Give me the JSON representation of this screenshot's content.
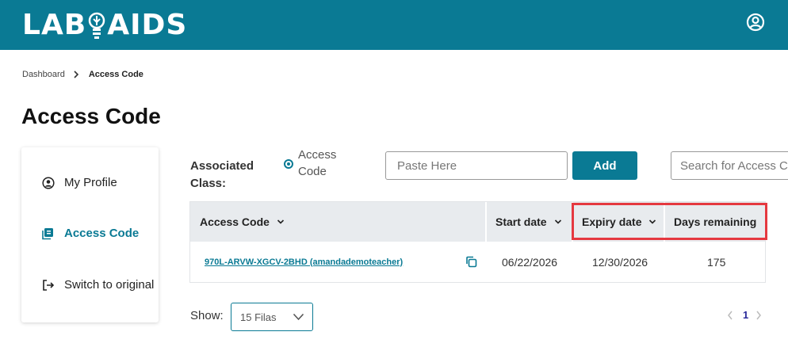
{
  "header": {
    "logo_left": "LAB",
    "logo_right": "AIDS",
    "brand_color": "#0a7a94"
  },
  "breadcrumb": {
    "items": [
      "Dashboard"
    ],
    "current": "Access Code"
  },
  "page": {
    "title": "Access Code"
  },
  "sidebar": {
    "items": [
      {
        "label": "My Profile",
        "icon": "user-circle-icon",
        "active": false
      },
      {
        "label": "Access Code",
        "icon": "books-icon",
        "active": true
      },
      {
        "label": "Switch to original",
        "icon": "sign-out-icon",
        "active": false
      }
    ]
  },
  "form": {
    "associated_label": "Associated Class:",
    "radio_label": "Access Code",
    "paste_placeholder": "Paste Here",
    "paste_value": "",
    "add_label": "Add",
    "search_placeholder": "Search for Access Code",
    "search_value": ""
  },
  "table": {
    "columns": [
      "Access Code",
      "Start date",
      "Expiry date",
      "Days remaining"
    ],
    "highlighted_columns": [
      "Expiry date",
      "Days remaining"
    ],
    "highlight_color": "#e53940",
    "rows": [
      {
        "code": "970L-ARVW-XGCV-2BHD (amandademoteacher)",
        "start": "06/22/2026",
        "expiry": "12/30/2026",
        "days": "175"
      }
    ]
  },
  "pagination": {
    "show_label": "Show:",
    "rows_option": "15 Filas",
    "current_page": "1"
  }
}
